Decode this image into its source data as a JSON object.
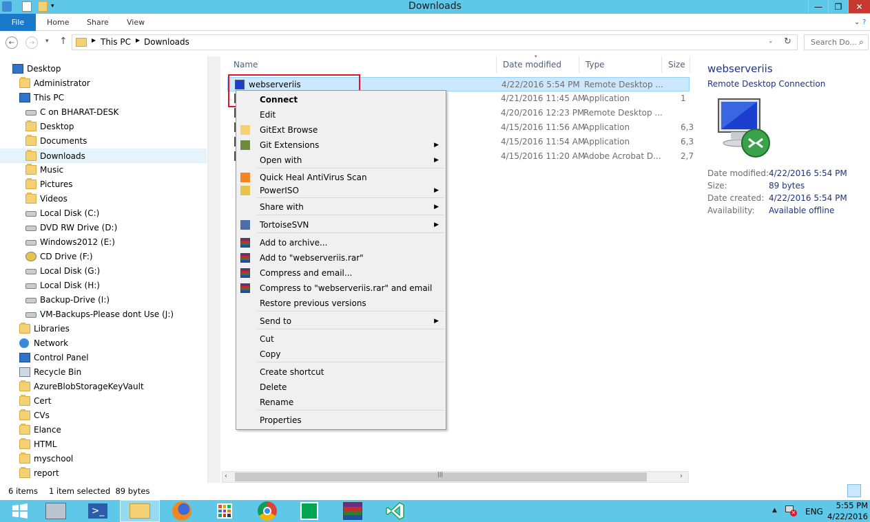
{
  "window": {
    "title": "Downloads"
  },
  "ribbon": {
    "tabs": [
      "File",
      "Home",
      "Share",
      "View"
    ]
  },
  "address": {
    "crumbs": [
      "This PC",
      "Downloads"
    ],
    "search_placeholder": "Search Do..."
  },
  "nav": {
    "items": [
      {
        "label": "Desktop",
        "icon": "monitor"
      },
      {
        "label": "Administrator",
        "icon": "folder"
      },
      {
        "label": "This PC",
        "icon": "monitor"
      },
      {
        "label": "C on BHARAT-DESK",
        "icon": "drive"
      },
      {
        "label": "Desktop",
        "icon": "folder"
      },
      {
        "label": "Documents",
        "icon": "folder"
      },
      {
        "label": "Downloads",
        "icon": "folder"
      },
      {
        "label": "Music",
        "icon": "folder"
      },
      {
        "label": "Pictures",
        "icon": "folder"
      },
      {
        "label": "Videos",
        "icon": "folder"
      },
      {
        "label": "Local Disk (C:)",
        "icon": "drive"
      },
      {
        "label": "DVD RW Drive (D:)",
        "icon": "drive"
      },
      {
        "label": "Windows2012 (E:)",
        "icon": "drive"
      },
      {
        "label": "CD Drive (F:)",
        "icon": "cd"
      },
      {
        "label": "Local Disk (G:)",
        "icon": "drive"
      },
      {
        "label": "Local Disk (H:)",
        "icon": "drive"
      },
      {
        "label": "Backup-Drive (I:)",
        "icon": "drive"
      },
      {
        "label": "VM-Backups-Please dont Use (J:)",
        "icon": "drive"
      },
      {
        "label": "Libraries",
        "icon": "folder"
      },
      {
        "label": "Network",
        "icon": "network"
      },
      {
        "label": "Control Panel",
        "icon": "monitor"
      },
      {
        "label": "Recycle Bin",
        "icon": "bin"
      },
      {
        "label": "AzureBlobStorageKeyVault",
        "icon": "folder"
      },
      {
        "label": "Cert",
        "icon": "folder"
      },
      {
        "label": "CVs",
        "icon": "folder"
      },
      {
        "label": "Elance",
        "icon": "folder"
      },
      {
        "label": "HTML",
        "icon": "folder"
      },
      {
        "label": "myschool",
        "icon": "folder"
      },
      {
        "label": "report",
        "icon": "folder"
      }
    ]
  },
  "filelist": {
    "columns": [
      "Name",
      "Date modified",
      "Type",
      "Size"
    ],
    "rows": [
      {
        "name": "webserveriis",
        "date": "4/22/2016 5:54 PM",
        "type": "Remote Desktop ...",
        "size": ""
      },
      {
        "name": "",
        "date": "4/21/2016 11:45 AM",
        "type": "Application",
        "size": "1"
      },
      {
        "name": "",
        "date": "4/20/2016 12:23 PM",
        "type": "Remote Desktop ...",
        "size": ""
      },
      {
        "name": "",
        "date": "4/15/2016 11:56 AM",
        "type": "Application",
        "size": "6,3"
      },
      {
        "name": "",
        "date": "4/15/2016 11:54 AM",
        "type": "Application",
        "size": "6,3"
      },
      {
        "name": "",
        "date": "4/15/2016 11:20 AM",
        "type": "Adobe Acrobat D...",
        "size": "2,7"
      }
    ]
  },
  "context_menu": {
    "items": [
      {
        "label": "Connect",
        "bold": true
      },
      {
        "label": "Edit"
      },
      {
        "label": "GitExt Browse"
      },
      {
        "label": "Git Extensions",
        "submenu": true
      },
      {
        "label": "Open with",
        "submenu": true
      },
      {
        "label": "Quick Heal AntiVirus Scan"
      },
      {
        "label": "PowerISO",
        "submenu": true
      },
      {
        "label": "Share with",
        "submenu": true
      },
      {
        "label": "TortoiseSVN",
        "submenu": true
      },
      {
        "label": "Add to archive..."
      },
      {
        "label": "Add to \"webserveriis.rar\""
      },
      {
        "label": "Compress and email..."
      },
      {
        "label": "Compress to \"webserveriis.rar\" and email"
      },
      {
        "label": "Restore previous versions"
      },
      {
        "label": "Send to",
        "submenu": true
      },
      {
        "label": "Cut"
      },
      {
        "label": "Copy"
      },
      {
        "label": "Create shortcut"
      },
      {
        "label": "Delete"
      },
      {
        "label": "Rename"
      },
      {
        "label": "Properties"
      }
    ]
  },
  "details": {
    "name": "webserveriis",
    "type": "Remote Desktop Connection",
    "props": [
      {
        "label": "Date modified:",
        "value": "4/22/2016 5:54 PM"
      },
      {
        "label": "Size:",
        "value": "89 bytes"
      },
      {
        "label": "Date created:",
        "value": "4/22/2016 5:54 PM"
      },
      {
        "label": "Availability:",
        "value": "Available offline"
      }
    ]
  },
  "status": {
    "count": "6 items",
    "selection": "1 item selected  89 bytes"
  },
  "taskbar": {
    "lang": "ENG",
    "time": "5:55 PM",
    "date": "4/22/2016"
  },
  "colors": {
    "accent": "#1979ca",
    "titlebar": "#5fc7e8",
    "selection": "#cce8ff",
    "highlight_box": "#e81123"
  }
}
